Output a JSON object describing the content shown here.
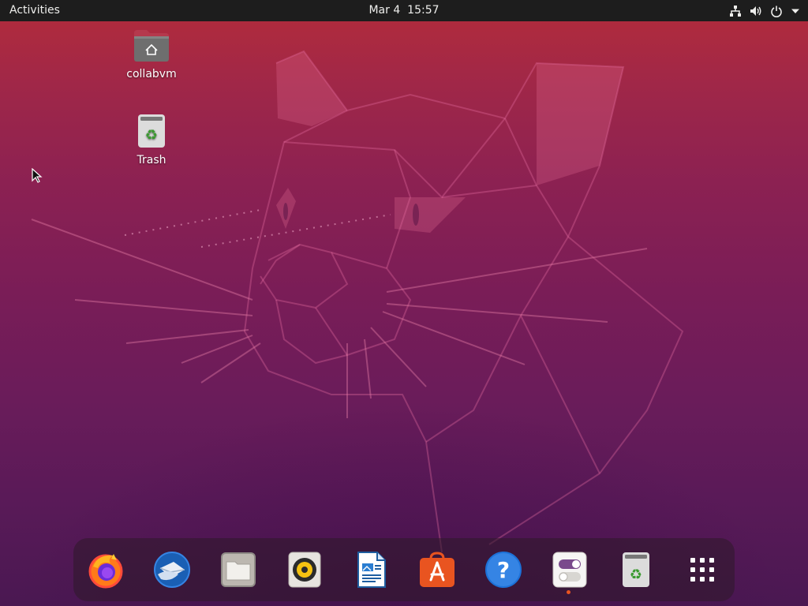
{
  "topbar": {
    "activities_label": "Activities",
    "date": "Mar 4",
    "time": "15:57",
    "tray_icons": [
      "network-wired-icon",
      "volume-icon",
      "power-icon",
      "system-menu-arrow-icon"
    ]
  },
  "desktop": {
    "icons": [
      {
        "label": "collabvm",
        "icon": "home-folder-icon"
      },
      {
        "label": "Trash",
        "icon": "trash-icon"
      }
    ]
  },
  "dock": {
    "items": [
      {
        "icon": "firefox-icon"
      },
      {
        "icon": "thunderbird-icon"
      },
      {
        "icon": "files-icon"
      },
      {
        "icon": "rhythmbox-icon"
      },
      {
        "icon": "libreoffice-writer-icon"
      },
      {
        "icon": "ubuntu-software-icon"
      },
      {
        "icon": "help-icon"
      },
      {
        "icon": "settings-icon",
        "running": true
      },
      {
        "icon": "trash-icon"
      },
      {
        "icon": "show-applications-icon"
      }
    ]
  },
  "colors": {
    "topbar": "#1d1d1d",
    "accent": "#e95420",
    "wallpaper_top": "#b42c3a",
    "wallpaper_bottom": "#4a1852"
  }
}
